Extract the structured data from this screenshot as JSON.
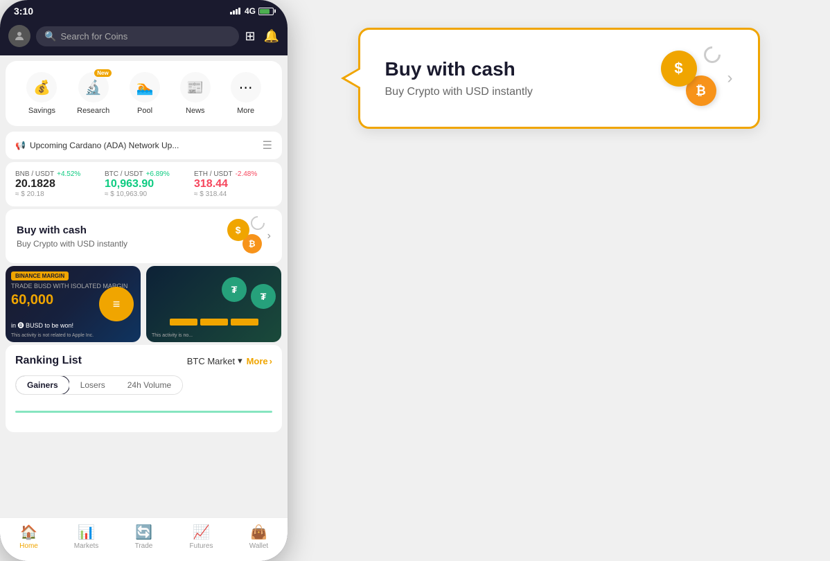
{
  "status": {
    "time": "3:10",
    "network": "4G"
  },
  "header": {
    "search_placeholder": "Search for Coins"
  },
  "quick_access": {
    "items": [
      {
        "label": "Savings",
        "icon": "💰",
        "new": false
      },
      {
        "label": "Research",
        "icon": "🔬",
        "new": true
      },
      {
        "label": "Pool",
        "icon": "🏊",
        "new": false
      },
      {
        "label": "News",
        "icon": "📰",
        "new": false
      },
      {
        "label": "More",
        "icon": "⋯",
        "new": false
      }
    ]
  },
  "announcement": {
    "text": "Upcoming Cardano (ADA) Network Up..."
  },
  "prices": [
    {
      "pair": "BNB / USDT",
      "change": "+4.52%",
      "positive": true,
      "value": "20.1828",
      "usd": "≈ $ 20.18"
    },
    {
      "pair": "BTC / USDT",
      "change": "+6.89%",
      "positive": true,
      "value": "10,963.90",
      "usd": "≈ $ 10,963.90"
    },
    {
      "pair": "ETH / USDT",
      "change": "-2.48%",
      "positive": false,
      "value": "318.44",
      "usd": "≈ $ 318.44"
    }
  ],
  "buy_cash": {
    "title": "Buy with cash",
    "subtitle": "Buy Crypto with USD instantly"
  },
  "promo": {
    "banner1": {
      "badge": "BINANCE MARGIN",
      "top_text": "TRADE BUSD WITH ISOLATED MARGIN",
      "amount": "60,000",
      "sub": "in BUSD to be won!",
      "disclaimer": "This activity is not related to Apple Inc."
    },
    "banner2": {
      "disclaimer": "This activity is no..."
    }
  },
  "ranking": {
    "title": "Ranking List",
    "market": "BTC Market",
    "more_label": "More",
    "tabs": [
      "Gainers",
      "Losers",
      "24h Volume"
    ]
  },
  "tooltip": {
    "title": "Buy with cash",
    "subtitle": "Buy Crypto with USD instantly"
  },
  "bottom_nav": {
    "items": [
      {
        "label": "Home",
        "icon": "🏠",
        "active": true
      },
      {
        "label": "Markets",
        "icon": "📊",
        "active": false
      },
      {
        "label": "Trade",
        "icon": "🔄",
        "active": false
      },
      {
        "label": "Futures",
        "icon": "📈",
        "active": false
      },
      {
        "label": "Wallet",
        "icon": "👜",
        "active": false
      }
    ]
  }
}
